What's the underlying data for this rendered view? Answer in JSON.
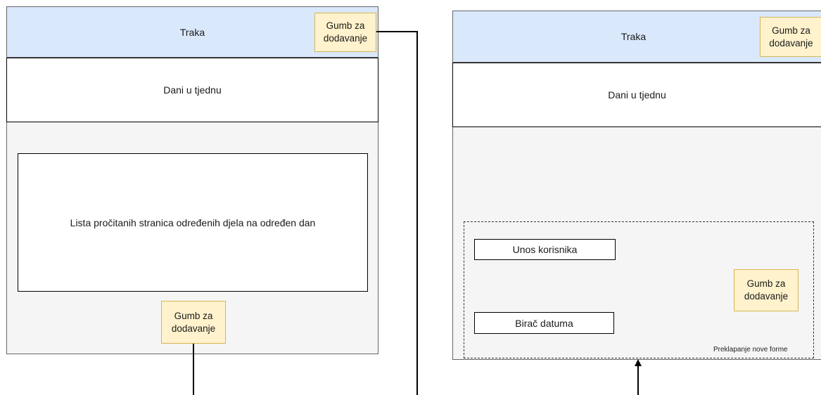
{
  "left_screen": {
    "bar_label": "Traka",
    "add_button_label": "Gumb za dodavanje",
    "days_label": "Dani u tjednu",
    "list_label": "Lista pročitanih stranica određenih djela na određen dan",
    "bottom_add_button_label": "Gumb za dodavanje"
  },
  "right_screen": {
    "bar_label": "Traka",
    "add_button_label": "Gumb za dodavanje",
    "days_label": "Dani u tjednu",
    "overlay": {
      "user_input_label": "Unos korisnika",
      "date_picker_label": "Birač datuma",
      "add_button_label": "Gumb za dodavanje",
      "caption": "Preklapanje nove forme"
    }
  },
  "colors": {
    "bar_blue": "#dae8fc",
    "button_yellow": "#fff2cc",
    "button_border": "#d6b656",
    "screen_gray": "#f5f5f5"
  }
}
